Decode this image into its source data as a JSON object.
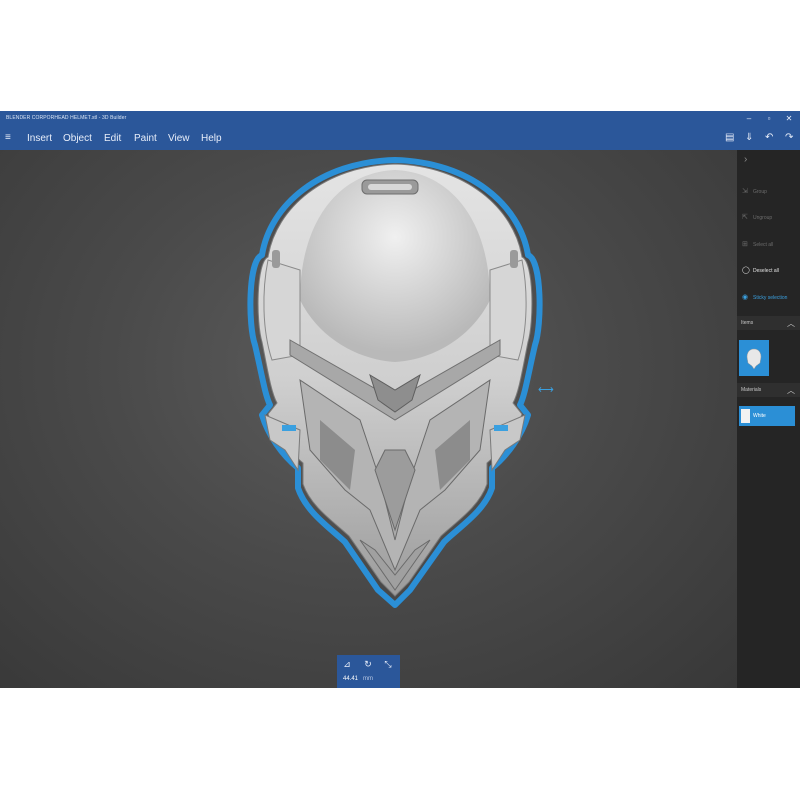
{
  "app": {
    "title": "BLENDER CORPORHEAD HELMET.stl - 3D Builder",
    "accent_color": "#2b579a",
    "selection_color": "#2b8fd6",
    "window_controls": [
      {
        "name": "minimize",
        "glyph": "–"
      },
      {
        "name": "maximize",
        "glyph": "▫"
      },
      {
        "name": "close",
        "glyph": "✕"
      }
    ]
  },
  "menu": {
    "hamburger": "≡",
    "items": [
      "Insert",
      "Object",
      "Edit",
      "Paint",
      "View",
      "Help"
    ]
  },
  "toolbar": {
    "icons": [
      {
        "name": "save",
        "glyph": "▤"
      },
      {
        "name": "download",
        "glyph": "⇓"
      },
      {
        "name": "undo",
        "glyph": "↶"
      },
      {
        "name": "redo",
        "glyph": "↷"
      }
    ]
  },
  "viewport": {
    "object_name": "helmet",
    "resize_arrow": "⟷",
    "transform_panel": {
      "icons": [
        {
          "name": "move",
          "glyph": "⊿"
        },
        {
          "name": "rotate",
          "glyph": "↻"
        },
        {
          "name": "scale",
          "glyph": "⤡"
        }
      ],
      "size_value": "44.41",
      "size_unit": "mm"
    }
  },
  "sidepanel": {
    "collapse_chevron": "›",
    "actions": [
      {
        "name": "group",
        "label": "Group",
        "icon": "⇲",
        "enabled": false
      },
      {
        "name": "ungroup",
        "label": "Ungroup",
        "icon": "⇱",
        "enabled": false
      },
      {
        "name": "select-all",
        "label": "Select all",
        "icon": "⊞",
        "enabled": false
      },
      {
        "name": "deselect-all",
        "label": "Deselect all",
        "icon": "◯",
        "enabled": true
      },
      {
        "name": "sticky-selection",
        "label": "Sticky selection",
        "icon": "◉",
        "enabled": true
      }
    ],
    "items_header": "Items",
    "materials_header": "Materials",
    "section_chevron": "︿",
    "material": {
      "label": "White",
      "swatch_color": "#f2f2f2"
    }
  }
}
